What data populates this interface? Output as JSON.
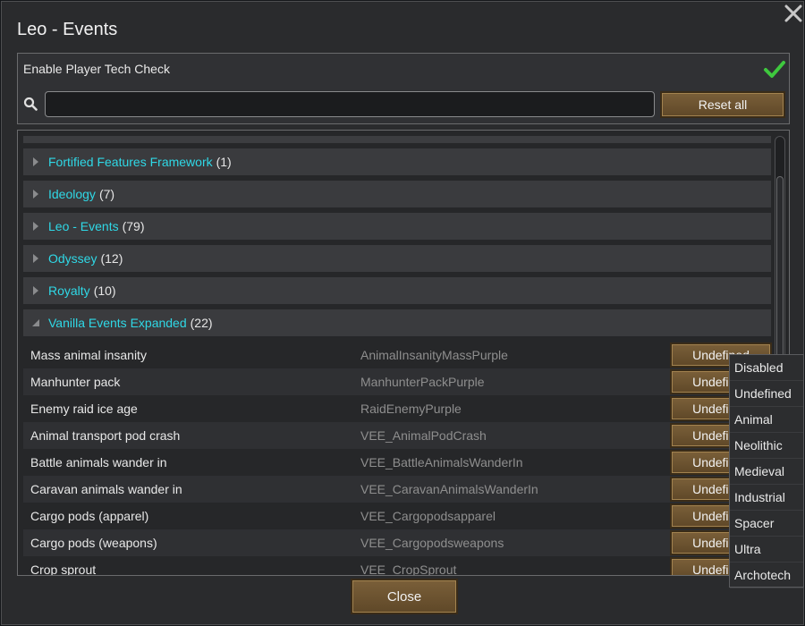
{
  "window": {
    "title": "Leo - Events"
  },
  "settings": {
    "tech_check_label": "Enable Player Tech Check",
    "tech_check_enabled": true,
    "search_value": "",
    "reset_label": "Reset all"
  },
  "categories": [
    {
      "name": "Fortified Features Framework",
      "count": "(1)",
      "expanded": false
    },
    {
      "name": "Ideology",
      "count": "(7)",
      "expanded": false
    },
    {
      "name": "Leo - Events",
      "count": "(79)",
      "expanded": false
    },
    {
      "name": "Odyssey",
      "count": "(12)",
      "expanded": false
    },
    {
      "name": "Royalty",
      "count": "(10)",
      "expanded": false
    },
    {
      "name": "Vanilla Events Expanded",
      "count": "(22)",
      "expanded": true
    }
  ],
  "items": [
    {
      "label": "Mass animal insanity",
      "def": "AnimalInsanityMassPurple",
      "value": "Undefined"
    },
    {
      "label": "Manhunter pack",
      "def": "ManhunterPackPurple",
      "value": "Undefined"
    },
    {
      "label": "Enemy raid ice age",
      "def": "RaidEnemyPurple",
      "value": "Undefined"
    },
    {
      "label": "Animal transport pod crash",
      "def": "VEE_AnimalPodCrash",
      "value": "Undefined"
    },
    {
      "label": "Battle animals wander in",
      "def": "VEE_BattleAnimalsWanderIn",
      "value": "Undefined"
    },
    {
      "label": "Caravan animals wander in",
      "def": "VEE_CaravanAnimalsWanderIn",
      "value": "Undefined"
    },
    {
      "label": "Cargo pods (apparel)",
      "def": "VEE_Cargopodsapparel",
      "value": "Undefined"
    },
    {
      "label": "Cargo pods (weapons)",
      "def": "VEE_Cargopodsweapons",
      "value": "Undefined"
    },
    {
      "label": "Crop sprout",
      "def": "VEE_CropSprout",
      "value": "Undefined"
    }
  ],
  "dropdown": {
    "options": [
      "Disabled",
      "Undefined",
      "Animal",
      "Neolithic",
      "Medieval",
      "Industrial",
      "Spacer",
      "Ultra",
      "Archotech"
    ]
  },
  "footer": {
    "close_label": "Close"
  },
  "icons": {
    "close": "close-icon",
    "check": "checkmark-icon",
    "search": "search-icon",
    "expand": "triangle-right-icon",
    "collapse": "triangle-down-icon"
  },
  "colors": {
    "category_text": "#2fd8e6",
    "check_green": "#3ec83e",
    "button_brown": "#6b5230"
  }
}
